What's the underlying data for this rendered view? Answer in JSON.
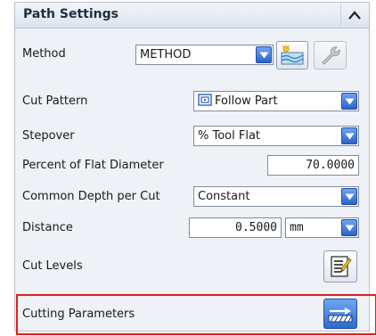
{
  "header": {
    "title": "Path Settings"
  },
  "method": {
    "label": "Method",
    "value": "METHOD"
  },
  "cut_pattern": {
    "label": "Cut Pattern",
    "value": "Follow Part"
  },
  "stepover": {
    "label": "Stepover",
    "value": "% Tool Flat"
  },
  "percent_flat": {
    "label": "Percent of Flat Diameter",
    "value": "70.0000"
  },
  "common_depth": {
    "label": "Common Depth per Cut",
    "value": "Constant"
  },
  "distance": {
    "label": "Distance",
    "value": "0.5000",
    "unit": "mm"
  },
  "cut_levels": {
    "label": "Cut Levels"
  },
  "cutting_parameters": {
    "label": "Cutting Parameters"
  },
  "colors": {
    "highlight": "#e02020",
    "accent": "#2c63c9"
  },
  "icons": [
    "collapse-up-icon",
    "new-method-icon",
    "edit-method-icon",
    "follow-part-icon",
    "cut-levels-icon",
    "cutting-parameters-icon"
  ]
}
